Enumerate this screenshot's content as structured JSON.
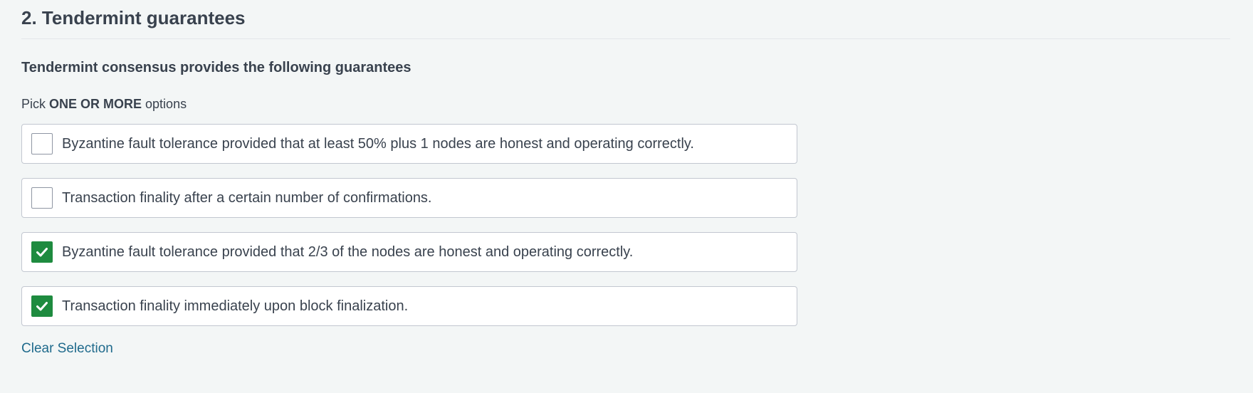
{
  "question": {
    "title": "2. Tendermint guarantees",
    "prompt": "Tendermint consensus provides the following guarantees",
    "instruction_prefix": "Pick ",
    "instruction_emphasis": "ONE OR MORE",
    "instruction_suffix": " options"
  },
  "options": [
    {
      "label": "Byzantine fault tolerance provided that at least 50% plus 1 nodes are honest and operating correctly.",
      "checked": false
    },
    {
      "label": "Transaction finality after a certain number of confirmations.",
      "checked": false
    },
    {
      "label": "Byzantine fault tolerance provided that 2/3 of the nodes are honest and operating correctly.",
      "checked": true
    },
    {
      "label": "Transaction finality immediately upon block finalization.",
      "checked": true
    }
  ],
  "actions": {
    "clear_label": "Clear Selection"
  },
  "colors": {
    "checked_fill": "#1e8b3f",
    "link": "#1f6a8c",
    "background": "#f3f6f6"
  },
  "icons": {
    "checkmark": "check-icon"
  }
}
